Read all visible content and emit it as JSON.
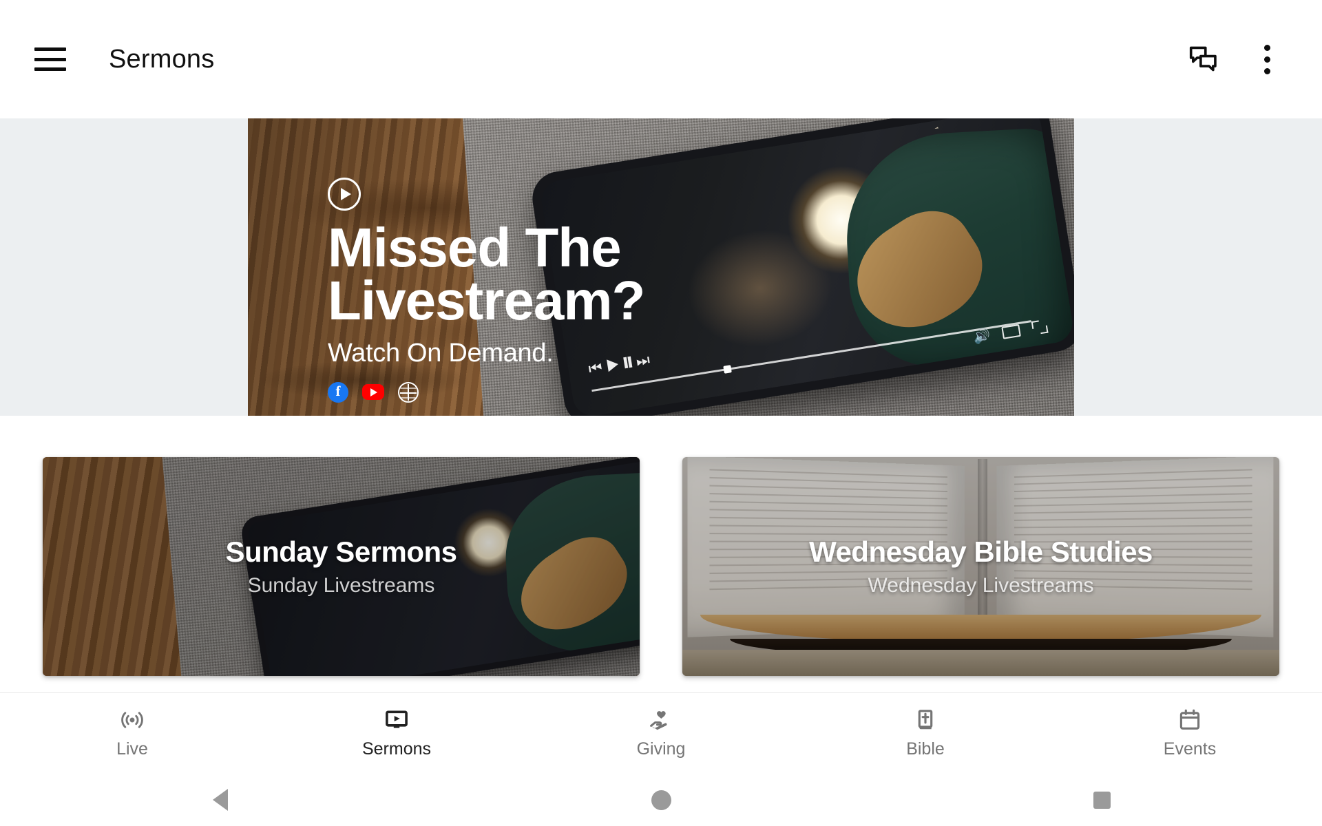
{
  "appbar": {
    "menu_icon": "hamburger-menu-icon",
    "title": "Sermons",
    "actions": [
      {
        "icon": "forum-chat-icon",
        "name": "chat"
      },
      {
        "icon": "more-vert-icon",
        "name": "overflow"
      }
    ]
  },
  "hero": {
    "play_icon": "play-circle-icon",
    "title_line1": "Missed The",
    "title_line2": "Livestream?",
    "subtitle": "Watch On Demand.",
    "socials": [
      {
        "name": "facebook-icon",
        "label": "f",
        "color": "#1877F2"
      },
      {
        "name": "youtube-icon",
        "label": "",
        "color": "#FF0000"
      },
      {
        "name": "website-globe-icon",
        "label": "",
        "color": "#FFFFFF"
      }
    ],
    "band_color": "#ECEFF1"
  },
  "cards": [
    {
      "title": "Sunday Sermons",
      "subtitle": "Sunday Livestreams",
      "art": "phone-on-wooden-table-photo"
    },
    {
      "title": "Wednesday Bible Studies",
      "subtitle": "Wednesday Livestreams",
      "art": "open-bible-photo"
    }
  ],
  "bottom_nav": {
    "active": "Sermons",
    "items": [
      {
        "label": "Live",
        "icon": "broadcast-live-icon",
        "active": false
      },
      {
        "label": "Sermons",
        "icon": "tv-play-icon",
        "active": true
      },
      {
        "label": "Giving",
        "icon": "hand-heart-icon",
        "active": false
      },
      {
        "label": "Bible",
        "icon": "book-cross-icon",
        "active": false
      },
      {
        "label": "Events",
        "icon": "calendar-icon",
        "active": false
      }
    ],
    "inactive_color": "#757575",
    "active_color": "#212121"
  },
  "system_nav": {
    "items": [
      {
        "name": "android-back-button",
        "icon": "triangle-back-icon"
      },
      {
        "name": "android-home-button",
        "icon": "circle-home-icon"
      },
      {
        "name": "android-recents-button",
        "icon": "square-recents-icon"
      }
    ],
    "color": "#9A9A9A"
  }
}
